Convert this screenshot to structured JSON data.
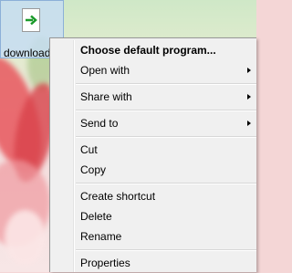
{
  "desktop": {
    "icon_label": "download"
  },
  "context_menu": {
    "items": [
      {
        "label": "Choose default program...",
        "bold": true,
        "submenu": false
      },
      {
        "label": "Open with",
        "submenu": true
      },
      {
        "label": "Share with",
        "submenu": true
      },
      {
        "label": "Send to",
        "submenu": true
      },
      {
        "label": "Cut"
      },
      {
        "label": "Copy"
      },
      {
        "label": "Create shortcut"
      },
      {
        "label": "Delete"
      },
      {
        "label": "Rename"
      },
      {
        "label": "Properties"
      }
    ]
  }
}
